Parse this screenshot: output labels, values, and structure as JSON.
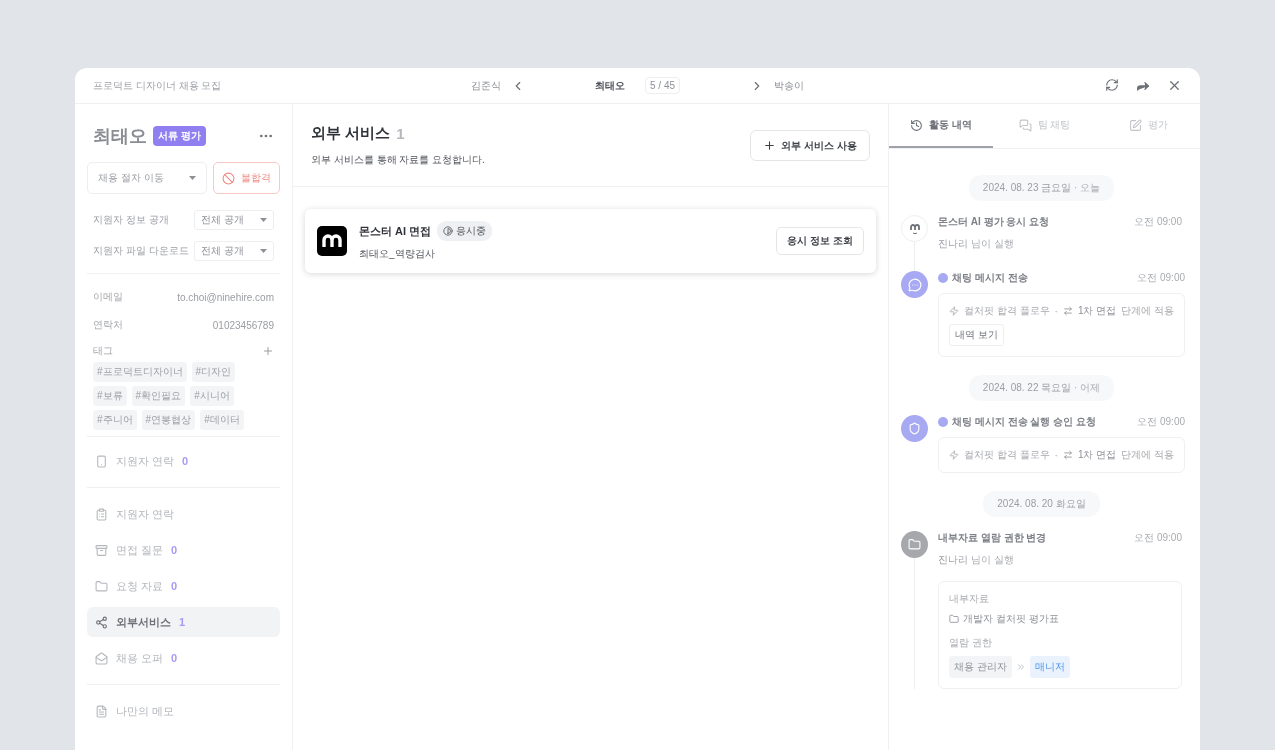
{
  "header": {
    "title": "프로덕트 디자이너 채용 모집",
    "prev": "김준식",
    "current": "최태오",
    "counter": "5 / 45",
    "next": "박송이"
  },
  "candidate": {
    "name": "최태오",
    "stage": "서류 평가",
    "move_select": "채용 절차 이동",
    "reject": "불합격",
    "settings": [
      {
        "label": "지원자 정보 공개",
        "value": "전체 공개"
      },
      {
        "label": "지원자 파일 다운로드",
        "value": "전체 공개"
      }
    ],
    "info": [
      {
        "label": "이메일",
        "value": "to.choi@ninehire.com"
      },
      {
        "label": "연락처",
        "value": "01023456789"
      }
    ],
    "tags_label": "태그",
    "tags": [
      [
        "#프로덕트디자이너",
        "#디자인"
      ],
      [
        "#보류",
        "#확인필요",
        "#시니어"
      ],
      [
        "#주니어",
        "#연봉협상",
        "#데이터"
      ]
    ]
  },
  "nav_sections": [
    [
      {
        "label": "지원자 연락",
        "count": "0",
        "selected": false
      }
    ],
    [
      {
        "label": "지원자 연락",
        "selected": false
      },
      {
        "label": "면접 질문",
        "count": "0",
        "selected": false
      },
      {
        "label": "요청 자료",
        "count": "0",
        "selected": false
      },
      {
        "label": "외부서비스",
        "count": "1",
        "selected": true
      },
      {
        "label": "채용 오퍼",
        "count": "0",
        "selected": false
      }
    ],
    [
      {
        "label": "나만의 메모",
        "selected": false
      }
    ]
  ],
  "main": {
    "title": "외부 서비스",
    "count": "1",
    "description": "외부 서비스를 통해 자료를 요청합니다.",
    "add_button": "외부 서비스 사용",
    "services": [
      {
        "name": "몬스터 AI 면접",
        "status": "응시중",
        "subtitle": "최태오_역량검사",
        "button": "응시 정보 조회"
      }
    ]
  },
  "tabs": [
    {
      "label": "활동 내역",
      "selected": true
    },
    {
      "label": "팀 채팅",
      "selected": false
    },
    {
      "label": "평가",
      "selected": false
    }
  ],
  "timeline": [
    {
      "date": "2024. 08. 23 금요일",
      "date_note": "· 오늘",
      "events": [
        {
          "kind": "logo",
          "title": "몬스터 AI 평가 응시 요청",
          "time": "오전 09:00",
          "actor": "진나리",
          "actor_note": "님이 실행",
          "connector": true
        },
        {
          "kind": "chat",
          "automated": true,
          "title": "채팅 메시지 전송",
          "time": "오전 09:00",
          "flow": {
            "name": "컬처핏 합격 플로우",
            "separator": "·",
            "stage": "1차 면접",
            "stage_note": "단계에 적용",
            "button": "내역 보기"
          },
          "connector": false
        }
      ]
    },
    {
      "date": "2024. 08. 22 목요일",
      "date_note": "· 어제",
      "events": [
        {
          "kind": "approval",
          "automated": true,
          "title": "채팅 메시지 전송 실행 승인 요청",
          "time": "오전 09:00",
          "flow": {
            "name": "컬처핏 합격 플로우",
            "separator": "·",
            "stage": "1차 면접",
            "stage_note": "단계에 적용"
          },
          "connector": false
        }
      ]
    },
    {
      "date": "2024. 08. 20 화요일",
      "events": [
        {
          "kind": "folder",
          "title": "내부자료 열람 권한 변경",
          "time": "오전 09:00",
          "actor": "진나리",
          "actor_note": "님이 실행",
          "permission": {
            "doc_label": "내부자료",
            "doc": "개발자 컬처핏 평가표",
            "perm_label": "열람 권한",
            "from": "채용 관리자",
            "to": "매니저"
          },
          "connector": true
        }
      ]
    }
  ]
}
